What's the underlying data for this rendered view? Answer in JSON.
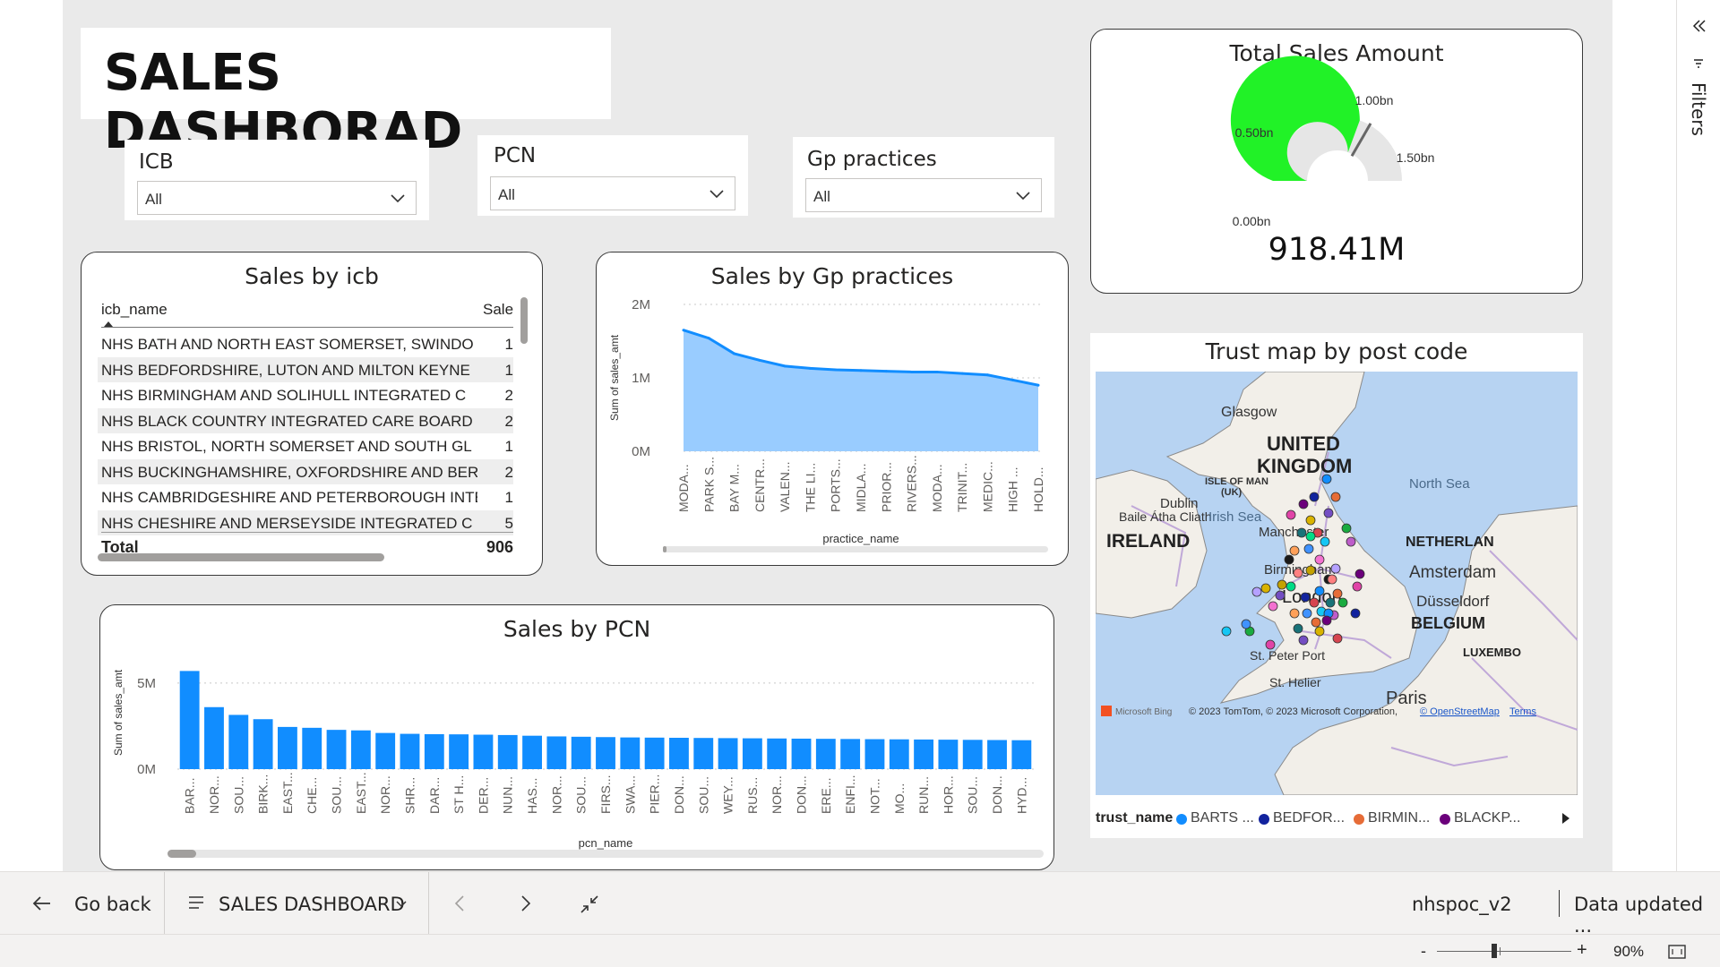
{
  "title": "SALES DASHBORAD",
  "slicers": [
    {
      "label": "ICB",
      "value": "All"
    },
    {
      "label": "PCN",
      "value": "All"
    },
    {
      "label": "Gp practices",
      "value": "All"
    }
  ],
  "icb_table": {
    "title": "Sales by icb",
    "columns": [
      "icb_name",
      "Sale"
    ],
    "rows": [
      {
        "name": "NHS BATH AND NORTH EAST SOMERSET, SWINDO",
        "value": "1"
      },
      {
        "name": "NHS BEDFORDSHIRE, LUTON AND MILTON KEYNE",
        "value": "1"
      },
      {
        "name": "NHS BIRMINGHAM AND SOLIHULL INTEGRATED C",
        "value": "2"
      },
      {
        "name": "NHS BLACK COUNTRY INTEGRATED CARE BOARD",
        "value": "2"
      },
      {
        "name": "NHS BRISTOL, NORTH SOMERSET AND SOUTH GL",
        "value": "1"
      },
      {
        "name": "NHS BUCKINGHAMSHIRE, OXFORDSHIRE AND BER",
        "value": "2"
      },
      {
        "name": "NHS CAMBRIDGESHIRE AND PETERBOROUGH INTE",
        "value": "1"
      },
      {
        "name": "NHS CHESHIRE AND MERSEYSIDE INTEGRATED C",
        "value": "5"
      }
    ],
    "total_label": "Total",
    "total_value": "906"
  },
  "gauge": {
    "title": "Total Sales Amount",
    "value_label": "918.41M",
    "min_label": "0.00bn",
    "t1_label": "0.50bn",
    "t2_label": "1.00bn",
    "max_label": "1.50bn",
    "value": 0.91841,
    "max": 1.5,
    "target": 1.0,
    "color": "#21f227"
  },
  "map": {
    "title": "Trust map by post code",
    "legend_title": "trust_name",
    "legend": [
      {
        "name": "BARTS ...",
        "color": "#118dff"
      },
      {
        "name": "BEDFOR...",
        "color": "#12239e"
      },
      {
        "name": "BIRMIN...",
        "color": "#e66c37"
      },
      {
        "name": "BLACKP...",
        "color": "#6b007b"
      }
    ],
    "labels": {
      "glasgow": "Glasgow",
      "uk1": "UNITED",
      "uk2": "KINGDOM",
      "isle_of_man": "ISLE OF MAN",
      "isle_of_man_uk": "(UK)",
      "north_sea": "North Sea",
      "dublin": "Dublin",
      "baile": "Baile Átha Cliath",
      "irish_sea": "Irish Sea",
      "ireland": "IRELAND",
      "manchester": "Manchester",
      "birmingham": "Birmingham",
      "london": "London",
      "netherlands": "NETHERLAN",
      "amsterdam": "Amsterdam",
      "dusseldorf": "Düsseldorf",
      "belgium": "BELGIUM",
      "luxembourg": "LUXEMBO",
      "st_peter_port": "St. Peter Port",
      "st_helier": "St. Helier",
      "paris": "Paris",
      "bing": "Microsoft Bing",
      "copyright": "© 2023 TomTom, © 2023 Microsoft Corporation,",
      "osm": "© OpenStreetMap",
      "terms": "Terms"
    }
  },
  "chart_data": [
    {
      "type": "area",
      "title": "Sales by Gp practices",
      "xlabel": "practice_name",
      "ylabel": "Sum of sales_amt",
      "yticks": [
        "0M",
        "1M",
        "2M"
      ],
      "ylim": [
        0,
        2000000
      ],
      "categories": [
        "MODA...",
        "PARK S...",
        "BAY M...",
        "CENTR...",
        "VALEN...",
        "THE LI...",
        "PORTS...",
        "MIDLA...",
        "PRIOR...",
        "RIVERS...",
        "MODA...",
        "TRINIT...",
        "MEDIC...",
        "HIGH ...",
        "HOLD..."
      ],
      "values": [
        1650000,
        1540000,
        1330000,
        1240000,
        1160000,
        1130000,
        1110000,
        1100000,
        1090000,
        1080000,
        1080000,
        1060000,
        1040000,
        970000,
        900000
      ],
      "color": "#118dff",
      "fill": "#99ccff"
    },
    {
      "type": "bar",
      "title": "Sales by PCN",
      "xlabel": "pcn_name",
      "ylabel": "Sum of sales_amt",
      "yticks": [
        "0M",
        "5M"
      ],
      "ylim": [
        0,
        6500000
      ],
      "categories": [
        "BAR...",
        "NOR...",
        "SOU...",
        "BIRK...",
        "EAST...",
        "CHE...",
        "SOU...",
        "EAST...",
        "NOR...",
        "SHR...",
        "DAR...",
        "ST H...",
        "DER...",
        "NUN...",
        "HAS...",
        "NOR...",
        "SOU...",
        "FIRS...",
        "SWA...",
        "PIER...",
        "DON...",
        "SOU...",
        "WEY...",
        "RUS...",
        "NOR...",
        "DON...",
        "ERE...",
        "ENFI...",
        "NOT...",
        "MO...",
        "RUN...",
        "HOR...",
        "SOU...",
        "DON...",
        "HYD..."
      ],
      "values": [
        5700000,
        3600000,
        3150000,
        2900000,
        2450000,
        2400000,
        2280000,
        2250000,
        2100000,
        2050000,
        2030000,
        2020000,
        2000000,
        1980000,
        1940000,
        1900000,
        1880000,
        1860000,
        1840000,
        1830000,
        1820000,
        1810000,
        1800000,
        1790000,
        1780000,
        1770000,
        1760000,
        1750000,
        1740000,
        1730000,
        1720000,
        1710000,
        1700000,
        1690000,
        1680000
      ],
      "color": "#118dff"
    }
  ],
  "bottom": {
    "go_back": "Go back",
    "page_name": "SALES DASHBOARD",
    "dataset": "nhspoc_v2",
    "updated": "Data updated ...",
    "zoom": "90%",
    "zoom_minus": "-",
    "zoom_plus": "+"
  },
  "filters_label": "Filters"
}
